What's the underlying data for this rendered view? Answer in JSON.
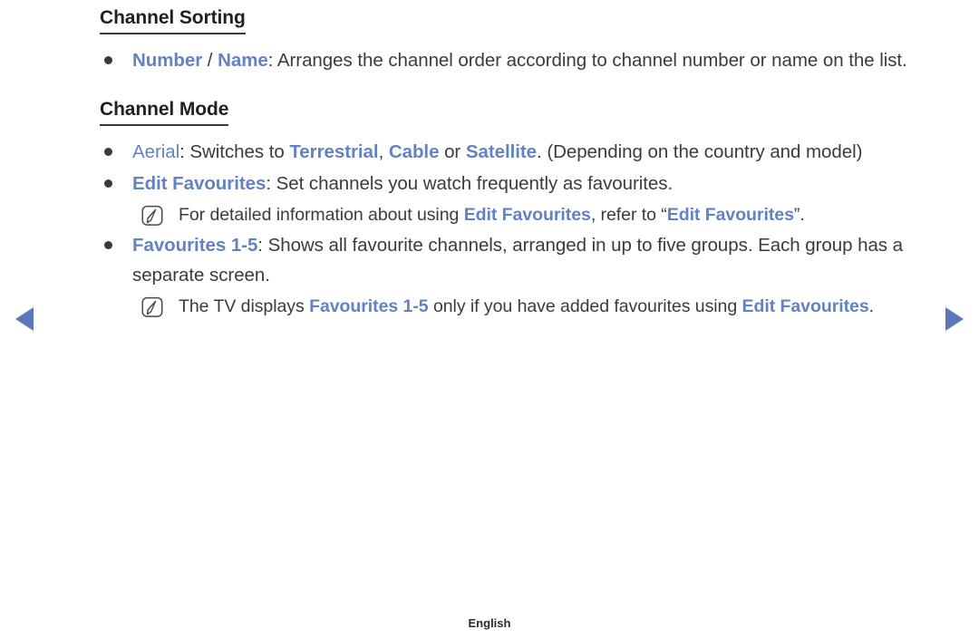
{
  "page": {
    "footer_label": "English",
    "accent_color": "#6382c4",
    "text_color": "#3b3b3b",
    "arrow_color": "#5b79b8"
  },
  "nav": {
    "prev_label": "previous-page",
    "next_label": "next-page"
  },
  "sections": [
    {
      "title": "Channel Sorting",
      "items": [
        {
          "type": "bullet",
          "parts": [
            {
              "text": "Number",
              "style": "keyword"
            },
            {
              "text": " / ",
              "style": "plain"
            },
            {
              "text": "Name",
              "style": "keyword"
            },
            {
              "text": ": Arranges the channel order according to channel number or name on the list.",
              "style": "plain"
            }
          ]
        }
      ]
    },
    {
      "title": "Channel Mode",
      "items": [
        {
          "type": "bullet",
          "parts": [
            {
              "text": "Aerial",
              "style": "keyword-light"
            },
            {
              "text": ": Switches to ",
              "style": "plain"
            },
            {
              "text": "Terrestrial",
              "style": "keyword"
            },
            {
              "text": ", ",
              "style": "plain"
            },
            {
              "text": "Cable",
              "style": "keyword"
            },
            {
              "text": " or ",
              "style": "plain"
            },
            {
              "text": "Satellite",
              "style": "keyword"
            },
            {
              "text": ". (Depending on the country and model)",
              "style": "plain"
            }
          ]
        },
        {
          "type": "bullet",
          "parts": [
            {
              "text": "Edit Favourites",
              "style": "keyword"
            },
            {
              "text": ": Set channels you watch frequently as favourites.",
              "style": "plain"
            }
          ]
        },
        {
          "type": "note",
          "icon": "note-pencil-icon",
          "parts": [
            {
              "text": "For detailed information about using ",
              "style": "plain"
            },
            {
              "text": "Edit Favourites",
              "style": "keyword"
            },
            {
              "text": ", refer to “",
              "style": "plain"
            },
            {
              "text": "Edit Favourites",
              "style": "keyword"
            },
            {
              "text": "”.",
              "style": "plain"
            }
          ]
        },
        {
          "type": "bullet",
          "parts": [
            {
              "text": "Favourites 1-5",
              "style": "keyword"
            },
            {
              "text": ": Shows all favourite channels, arranged in up to five groups. Each group has a separate screen.",
              "style": "plain"
            }
          ]
        },
        {
          "type": "note",
          "icon": "note-pencil-icon",
          "parts": [
            {
              "text": "The TV displays ",
              "style": "plain"
            },
            {
              "text": "Favourites 1-5",
              "style": "keyword"
            },
            {
              "text": " only if you have added favourites using ",
              "style": "plain"
            },
            {
              "text": "Edit Favourites",
              "style": "keyword"
            },
            {
              "text": ".",
              "style": "plain"
            }
          ]
        }
      ]
    }
  ]
}
